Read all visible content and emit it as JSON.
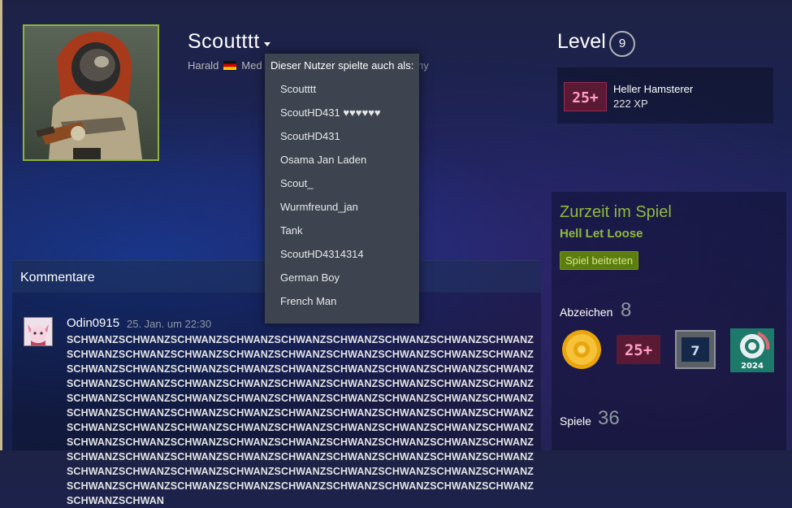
{
  "profile": {
    "persona_name": "Scoutttt",
    "real_name": "Harald",
    "location_partial": "Med",
    "location_tail": "ny",
    "flag": "germany-flag-icon"
  },
  "level": {
    "label": "Level",
    "value": "9",
    "xp_badge_text": "25+",
    "xp_title": "Heller Hamsterer",
    "xp_amount": "222 XP"
  },
  "in_game": {
    "title": "Zurzeit im Spiel",
    "game": "Hell Let Loose",
    "join_label": "Spiel beitreten"
  },
  "badges": {
    "label": "Abzeichen",
    "count": "8",
    "items": [
      {
        "name": "gold-coin-badge-icon"
      },
      {
        "name": "25-plus-badge-icon",
        "text": "25+"
      },
      {
        "name": "years-of-service-badge-icon",
        "text": "7"
      },
      {
        "name": "steam-replay-2024-badge-icon",
        "text": "2024"
      }
    ]
  },
  "games": {
    "label": "Spiele",
    "count": "36"
  },
  "comments": {
    "title": "Kommentare",
    "items": [
      {
        "author": "Odin0915",
        "time": "25. Jan. um 22:30",
        "text": "SCHWANZSCHWANZSCHWANZSCHWANZSCHWANZSCHWANZSCHWANZSCHWANZSCHWANZSCHWANZSCHWANZSCHWANZSCHWANZSCHWANZSCHWANZSCHWANZSCHWANZSCHWANZSCHWANZSCHWANZSCHWANZSCHWANZSCHWANZSCHWANZSCHWANZSCHWANZSCHWANZSCHWANZSCHWANZSCHWANZSCHWANZSCHWANZSCHWANZSCHWANZSCHWANZSCHWANZSCHWANZSCHWANZSCHWANZSCHWANZSCHWANZSCHWANZSCHWANZSCHWANZSCHWANZSCHWANZSCHWANZSCHWANZSCHWANZSCHWANZSCHWANZSCHWANZSCHWANZSCHWANZSCHWANZSCHWANZSCHWANZSCHWANZSCHWANZSCHWANZSCHWANZSCHWANZSCHWANZSCHWANZSCHWANZSCHWANZSCHWANZSCHWANZSCHWANZSCHWANZSCHWANZSCHWANZSCHWANZSCHWANZSCHWANZSCHWANZSCHWANZSCHWANZSCHWANZSCHWANZSCHWANZSCHWANZSCHWANZSCHWANZSCHWANZSCHWANZSCHWANZSCHWANZSCHWANZSCHWANZSCHWANZSCHWANZSCHWANZSCHWANZSCHWANZSCHWANZSCHWANZSCHWANZSCHWANZSCHWANZSCHWAN"
      }
    ]
  },
  "alias_dropdown": {
    "title": "Dieser Nutzer spielte auch als:",
    "items": [
      "Scoutttt",
      "ScoutHD431 ♥♥♥♥♥♥",
      "ScoutHD431",
      "Osama Jan Laden",
      "Scout_",
      "Wurmfreund_jan",
      "Tank",
      "ScoutHD4314314",
      "German Boy",
      "French Man"
    ]
  },
  "colors": {
    "accent_green": "#90ba3c",
    "avatar_border": "#8fb33a",
    "popup_bg": "#3d4450",
    "join_button": "#5c7e10"
  }
}
